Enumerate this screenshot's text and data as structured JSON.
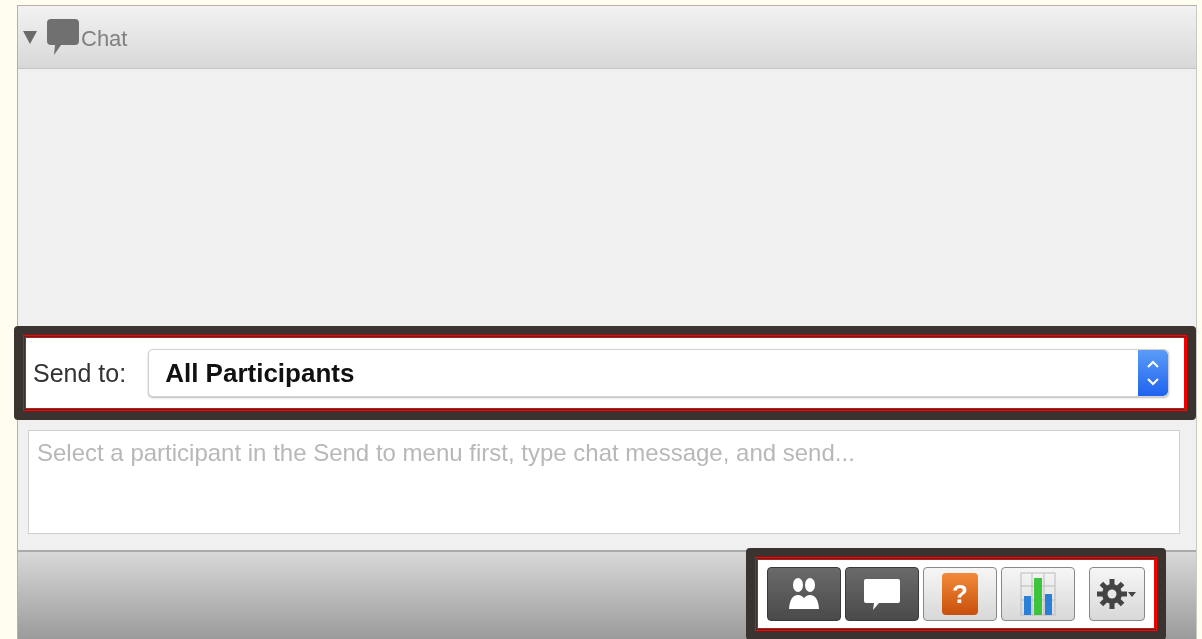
{
  "panel": {
    "title": "Chat",
    "expanded": true
  },
  "send_to": {
    "label": "Send to:",
    "value": "All Participants"
  },
  "message": {
    "placeholder": "Select a participant in the Send to menu first, type chat message, and send..."
  },
  "toolbar": [
    {
      "kind": "participants",
      "selected": true
    },
    {
      "kind": "chat",
      "selected": true
    },
    {
      "kind": "help",
      "selected": false,
      "glyph": "?"
    },
    {
      "kind": "polling",
      "selected": false
    },
    {
      "kind": "settings",
      "selected": false
    }
  ]
}
